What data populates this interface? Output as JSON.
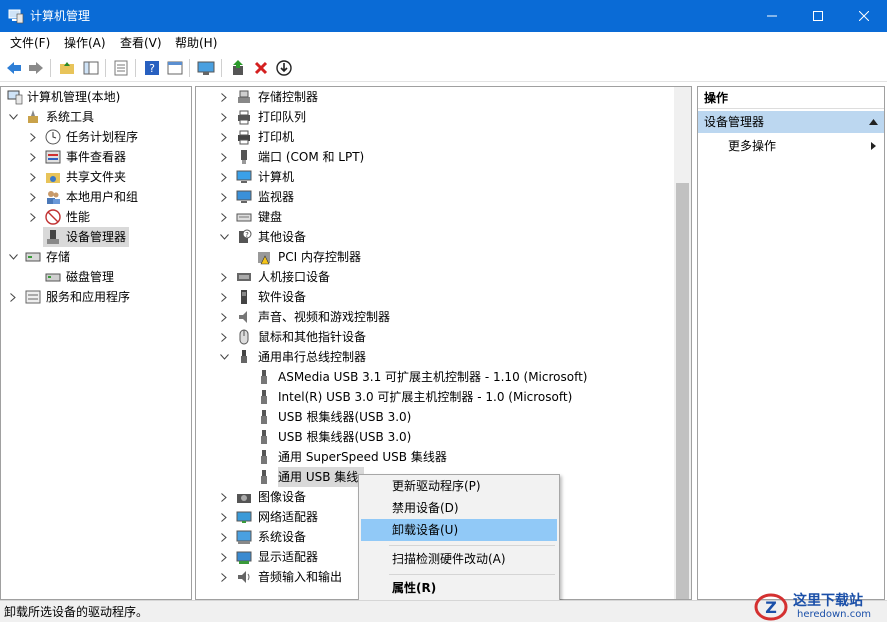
{
  "window": {
    "title": "计算机管理"
  },
  "menu": [
    "文件(F)",
    "操作(A)",
    "查看(V)",
    "帮助(H)"
  ],
  "left_tree": {
    "root": "计算机管理(本地)",
    "system_tools": "系统工具",
    "items": [
      "任务计划程序",
      "事件查看器",
      "共享文件夹",
      "本地用户和组",
      "性能",
      "设备管理器"
    ],
    "storage": "存储",
    "disk": "磁盘管理",
    "services": "服务和应用程序"
  },
  "device_tree": {
    "top": [
      "存储控制器",
      "打印队列",
      "打印机",
      "端口 (COM 和 LPT)",
      "计算机",
      "监视器",
      "键盘"
    ],
    "other_devices": "其他设备",
    "pci": "PCI 内存控制器",
    "middle": [
      "人机接口设备",
      "软件设备",
      "声音、视频和游戏控制器",
      "鼠标和其他指针设备"
    ],
    "usb": "通用串行总线控制器",
    "usb_children": [
      "ASMedia USB 3.1 可扩展主机控制器 - 1.10 (Microsoft)",
      "Intel(R) USB 3.0 可扩展主机控制器 - 1.0 (Microsoft)",
      "USB 根集线器(USB 3.0)",
      "USB 根集线器(USB 3.0)",
      "通用 SuperSpeed USB 集线器",
      "通用 USB 集线"
    ],
    "bottom": [
      "图像设备",
      "网络适配器",
      "系统设备",
      "显示适配器",
      "音频输入和输出"
    ]
  },
  "actions": {
    "header": "操作",
    "section": "设备管理器",
    "more": "更多操作"
  },
  "context_menu": {
    "update": "更新驱动程序(P)",
    "disable": "禁用设备(D)",
    "uninstall": "卸载设备(U)",
    "scan": "扫描检测硬件改动(A)",
    "properties": "属性(R)"
  },
  "status": "卸载所选设备的驱动程序。",
  "watermark": {
    "brand": "这里下载站",
    "url": "heredown.com"
  },
  "colors": {
    "titlebar": "#0a6bd6",
    "selection": "#91c9f7",
    "action_section": "#bcd7f0"
  }
}
